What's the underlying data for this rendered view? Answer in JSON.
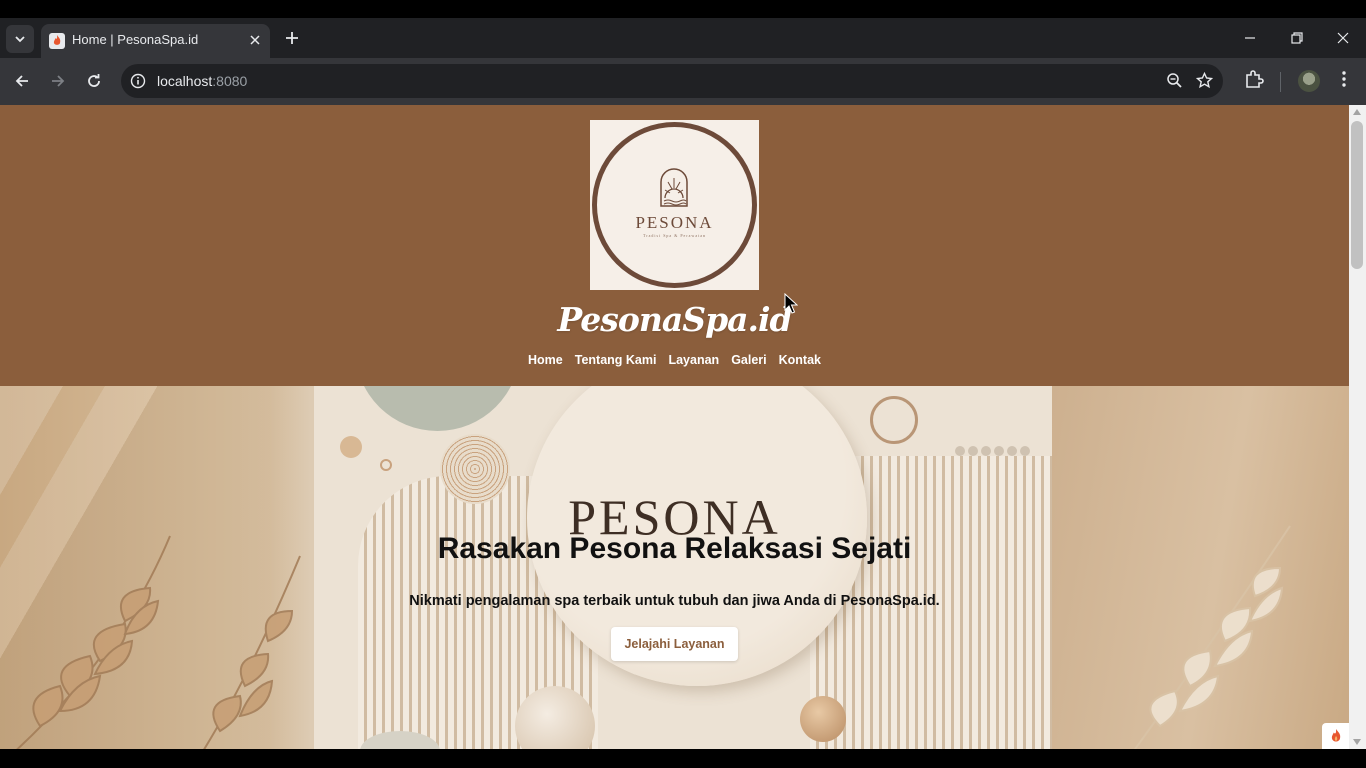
{
  "browser": {
    "tab_title": "Home | PesonaSpa.id",
    "url_host": "localhost",
    "url_port": ":8080",
    "icons": {
      "tab_search": "chevron-down-icon",
      "favicon": "flame-icon",
      "tab_close": "close-icon",
      "new_tab": "plus-icon",
      "minimize": "minimize-icon",
      "restore": "restore-icon",
      "close_window": "close-icon",
      "back": "back-arrow-icon",
      "forward": "forward-arrow-icon",
      "reload": "reload-icon",
      "site_info": "info-icon",
      "zoom": "zoom-icon",
      "bookmark": "star-icon",
      "extensions": "puzzle-icon",
      "profile": "avatar",
      "menu": "kebab-menu-icon"
    }
  },
  "site": {
    "logo": {
      "wordmark": "PESONA",
      "tagline": "Tradisi Spa & Perawatan"
    },
    "brand_name": "PesonaSpa.id",
    "nav": [
      "Home",
      "Tentang Kami",
      "Layanan",
      "Galeri",
      "Kontak"
    ],
    "hero": {
      "image_wordmark": "PESONA",
      "title": "Rasakan Pesona Relaksasi Sejati",
      "subtitle": "Nikmati pengalaman spa terbaik untuk tubuh dan jiwa Anda di PesonaSpa.id.",
      "cta_label": "Jelajahi Layanan"
    }
  },
  "colors": {
    "header_bg": "#8b5e3c",
    "logo_ring": "#6d4a39",
    "cta_text": "#8b5e3c",
    "browser_dark": "#202124",
    "browser_toolbar": "#35363a"
  }
}
